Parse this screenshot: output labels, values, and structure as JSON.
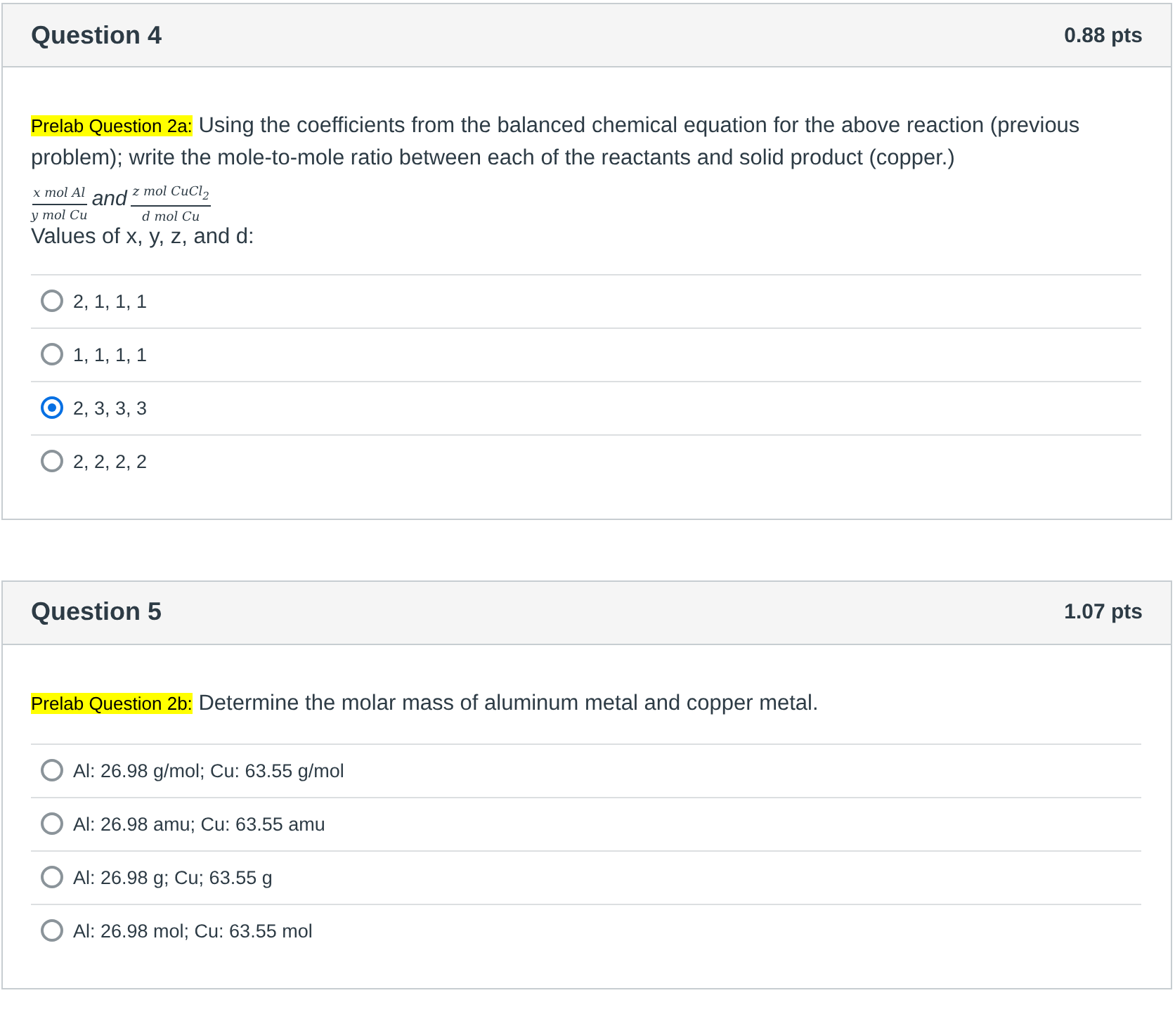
{
  "questions": [
    {
      "title": "Question 4",
      "points": "0.88 pts",
      "tag": "Prelab Question 2a:",
      "prompt": "Using the coefficients from the balanced chemical equation for the above reaction (previous problem); write the mole-to-mole ratio between each of the reactants and solid product (copper.)",
      "formula": {
        "left": {
          "numerator": "x mol Al",
          "denominator": "y mol Cu"
        },
        "connector": "and",
        "right": {
          "numerator": "z mol CuCl$_{2}$",
          "denominator": "d mol Cu"
        }
      },
      "after": "Values of x, y, z, and d:",
      "answers": [
        {
          "label": "2, 1, 1, 1",
          "selected": false
        },
        {
          "label": "1, 1, 1, 1",
          "selected": false
        },
        {
          "label": "2, 3, 3, 3",
          "selected": true
        },
        {
          "label": "2, 2, 2, 2",
          "selected": false
        }
      ]
    },
    {
      "title": "Question 5",
      "points": "1.07 pts",
      "tag": "Prelab Question 2b:",
      "prompt": "Determine the molar mass of aluminum metal and copper metal.",
      "answers": [
        {
          "label": "Al: 26.98 g/mol; Cu: 63.55 g/mol",
          "selected": false
        },
        {
          "label": "Al: 26.98 amu; Cu: 63.55 amu",
          "selected": false
        },
        {
          "label": "Al: 26.98 g; Cu; 63.55 g",
          "selected": false
        },
        {
          "label": "Al: 26.98 mol; Cu: 63.55 mol",
          "selected": false
        }
      ]
    }
  ]
}
